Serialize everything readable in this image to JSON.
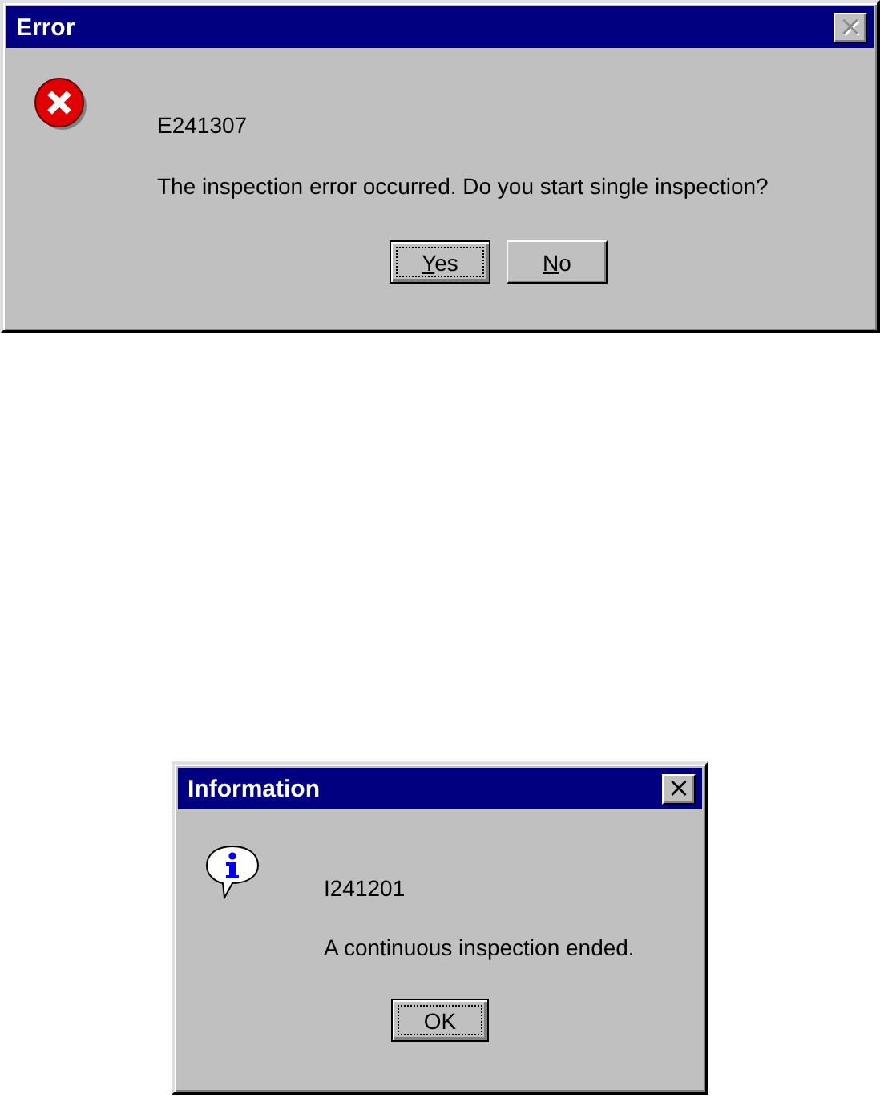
{
  "dialogs": [
    {
      "kind": "error",
      "title": "Error",
      "close": {
        "label": "×",
        "disabled": true
      },
      "code": "E241307",
      "message": "The inspection error occurred. Do you start single inspection?",
      "buttons": [
        {
          "accel": "Y",
          "rest": "es",
          "default": true
        },
        {
          "accel": "N",
          "rest": "o",
          "default": false
        }
      ]
    },
    {
      "kind": "info",
      "title": "Information",
      "close": {
        "label": "×",
        "disabled": false
      },
      "code": "I241201",
      "message": "A continuous inspection ended.",
      "buttons": [
        {
          "rest": "OK",
          "default": true
        }
      ]
    }
  ]
}
